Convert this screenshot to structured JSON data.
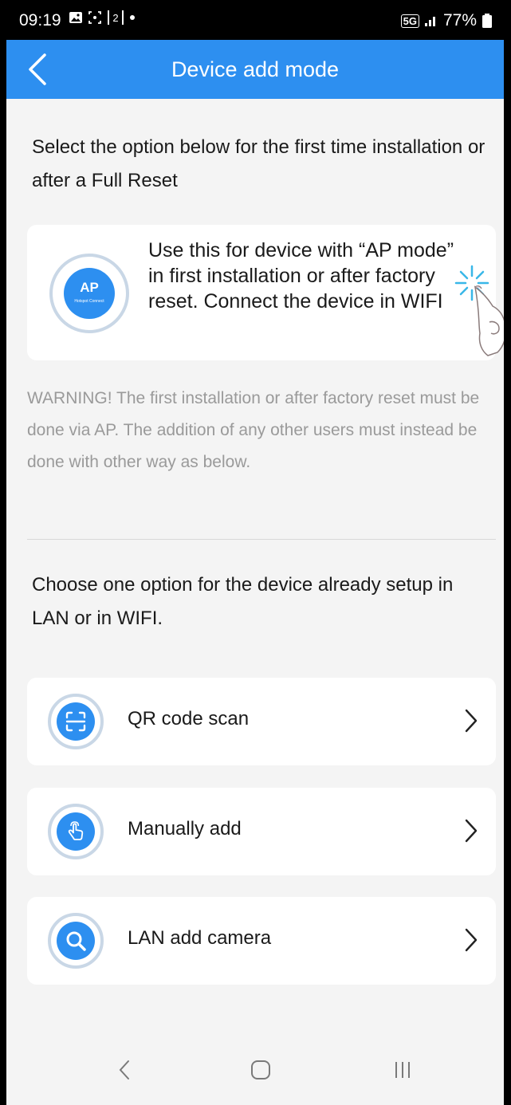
{
  "status_bar": {
    "time": "09:19",
    "icons": [
      "gallery-icon",
      "screen-icon",
      "sim2-icon",
      "dot-icon"
    ],
    "network": "5G",
    "battery": "77%"
  },
  "header": {
    "title": "Device add mode",
    "back_icon": "chevron-left-icon",
    "color": "#2d8ff0"
  },
  "first_install": {
    "heading": "Select the option below for the first time installation or after a Full Reset",
    "ap_card": {
      "icon_label": "AP",
      "icon_sublabel": "Hotspot Connect",
      "description": "Use this for device with “AP mode” in first installation or after factory reset. Connect the device in WIFI"
    },
    "warning": "WARNING! The first installation or after factory reset must be done via AP. The addition of any other users must instead be done with other way as below."
  },
  "existing_setup": {
    "heading": "Choose one option for the device already setup in LAN or in WIFI.",
    "options": [
      {
        "label": "QR code scan",
        "icon": "qr-scan-icon"
      },
      {
        "label": "Manually add",
        "icon": "hand-tap-icon"
      },
      {
        "label": "LAN add camera",
        "icon": "search-icon"
      }
    ]
  },
  "system_nav": [
    "back-icon",
    "home-icon",
    "recents-icon"
  ]
}
